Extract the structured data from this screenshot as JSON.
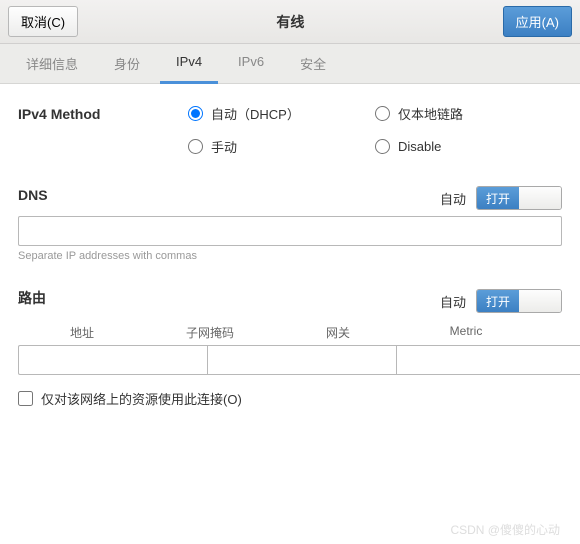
{
  "header": {
    "cancel": "取消(C)",
    "title": "有线",
    "apply": "应用(A)"
  },
  "tabs": {
    "detail": "详细信息",
    "identity": "身份",
    "ipv4": "IPv4",
    "ipv6": "IPv6",
    "security": "安全"
  },
  "method": {
    "label": "IPv4 Method",
    "auto": "自动（DHCP）",
    "link_local": "仅本地链路",
    "manual": "手动",
    "disable": "Disable"
  },
  "dns": {
    "label": "DNS",
    "auto": "自动",
    "toggle": "打开",
    "hint": "Separate IP addresses with commas",
    "value": ""
  },
  "routes": {
    "label": "路由",
    "auto": "自动",
    "toggle": "打开",
    "col_addr": "地址",
    "col_mask": "子网掩码",
    "col_gw": "网关",
    "col_metric": "Metric"
  },
  "local_only": "仅对该网络上的资源使用此连接(O)",
  "watermark": "CSDN @傻傻的心动"
}
